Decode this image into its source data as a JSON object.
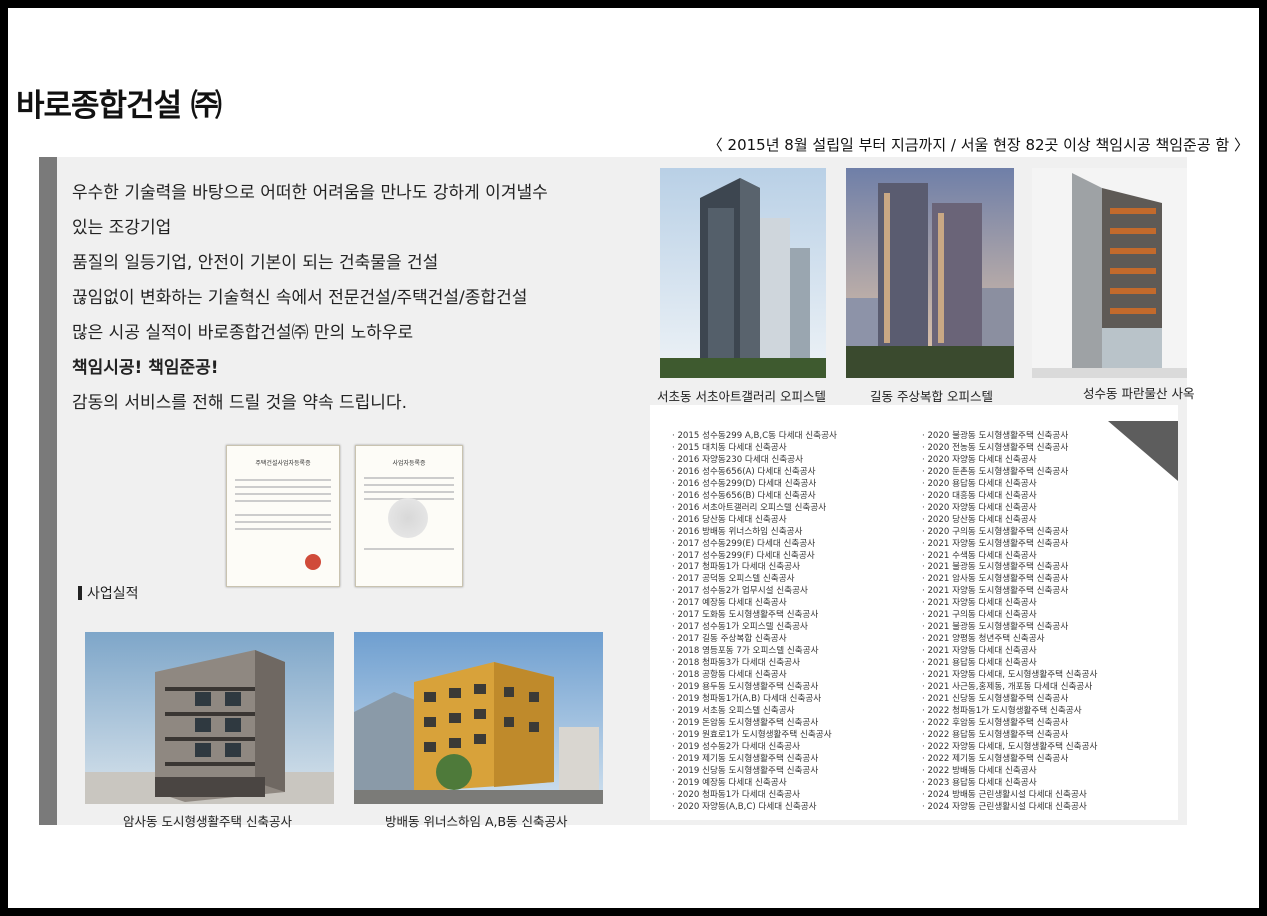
{
  "header": {
    "title": "바로종합건설 ㈜",
    "subtitle": "〈 2015년 8월 설립일 부터 지금까지 / 서울 현장 82곳 이상 책임시공 책임준공 함 〉"
  },
  "intro": {
    "lines": [
      "우수한 기술력을 바탕으로 어떠한 어려움을 만나도 강하게 이겨낼수",
      "있는 조강기업",
      "품질의 일등기업, 안전이 기본이 되는 건축물을 건설",
      "끊임없이 변화하는 기술혁신 속에서 전문건설/주택건설/종합건설",
      "많은 시공 실적이 바로종합건설㈜ 만의 노하우로",
      "책임시공! 책임준공!",
      "감동의 서비스를 전해 드릴 것을 약속 드립니다."
    ]
  },
  "section": {
    "label": "사업실적"
  },
  "projects_bottom": [
    {
      "caption": "암사동 도시형생활주택 신축공사"
    },
    {
      "caption": "방배동 위너스하임 A,B동 신축공사"
    }
  ],
  "projects_top": [
    {
      "caption": "서초동 서초아트갤러리 오피스텔"
    },
    {
      "caption": "길동 주상복합 오피스텔"
    },
    {
      "caption": "성수동 파란물산 사옥"
    }
  ],
  "project_list": {
    "left": [
      "2015 성수동299 A,B,C동 다세대 신축공사",
      "2015 대치동 다세대 신축공사",
      "2016 자양동230 다세대 신축공사",
      "2016 성수동656(A) 다세대 신축공사",
      "2016 성수동299(D) 다세대 신축공사",
      "2016 성수동656(B) 다세대 신축공사",
      "2016 서초아트갤러리 오피스텔 신축공사",
      "2016 당산동 다세대 신축공사",
      "2016 방배동 위너스하임 신축공사",
      "2017 성수동299(E) 다세대 신축공사",
      "2017 성수동299(F) 다세대 신축공사",
      "2017 청파동1가 다세대 신축공사",
      "2017 공덕동 오피스텔 신축공사",
      "2017 성수동2가 업무시설 신축공사",
      "2017 예장동 다세대 신축공사",
      "2017 도화동 도시형생활주택 신축공사",
      "2017 성수동1가 오피스텔 신축공사",
      "2017 길동 주상복합 신축공사",
      "2018 영등포동 7가 오피스텔 신축공사",
      "2018 청파동3가 다세대 신축공사",
      "2018 공항동 다세대 신축공사",
      "2019 용두동 도시형생활주택 신축공사",
      "2019 청파동1가(A,B) 다세대 신축공사",
      "2019 서초동 오피스텔 신축공사",
      "2019 돈암동 도시형생활주택 신축공사",
      "2019 원효로1가 도시형생활주택 신축공사",
      "2019 성수동2가 다세대 신축공사",
      "2019 제기동 도시형생활주택 신축공사",
      "2019 신당동 도시형생활주택 신축공사",
      "2019 예장동 다세대 신축공사",
      "2020 청파동1가 다세대 신축공사",
      "2020 자양동(A,B,C) 다세대 신축공사"
    ],
    "right": [
      "2020 불광동 도시형생활주택 신축공사",
      "2020 전농동 도시형생활주택 신축공사",
      "2020 자양동 다세대 신축공사",
      "2020 둔촌동 도시형생활주택 신축공사",
      "2020 용답동 다세대 신축공사",
      "2020 대흥동 다세대 신축공사",
      "2020 자양동 다세대 신축공사",
      "2020 당산동 다세대 신축공사",
      "2020 구의동 도시형생활주택 신축공사",
      "2021 자양동 도시형생활주택 신축공사",
      "2021 수색동 다세대 신축공사",
      "2021 불광동 도시형생활주택 신축공사",
      "2021 암사동 도시형생활주택 신축공사",
      "2021 자양동 도시형생활주택 신축공사",
      "2021 자양동 다세대 신축공사",
      "2021 구의동 다세대 신축공사",
      "2021 불광동 도시형생활주택 신축공사",
      "2021 양평동 청년주택 신축공사",
      "2021 자양동 다세대 신축공사",
      "2021 용답동 다세대 신축공사",
      "2021 자양동 다세대, 도시형생활주택 신축공사",
      "2021 사근동,홍제동, 개포동 다세대 신축공사",
      "2021 신당동 도시형생활주택 신축공사",
      "2022 청파동1가 도시형생활주택 신축공사",
      "2022 후암동 도시형생활주택 신축공사",
      "2022 용답동 도시형생활주택 신축공사",
      "2022 자양동 다세대, 도시형생활주택 신축공사",
      "2022 제기동 도시형생활주택 신축공사",
      "2022 방배동 다세대 신축공사",
      "2023 용답동 다세대 신축공사",
      "2024 방배동 근린생활시설 다세대 신축공사",
      "2024 자양동 근린생활시설 다세대 신축공사"
    ]
  },
  "certificates": [
    {
      "heading": "주택건설사업자등록증"
    },
    {
      "heading": "사업자등록증"
    }
  ]
}
